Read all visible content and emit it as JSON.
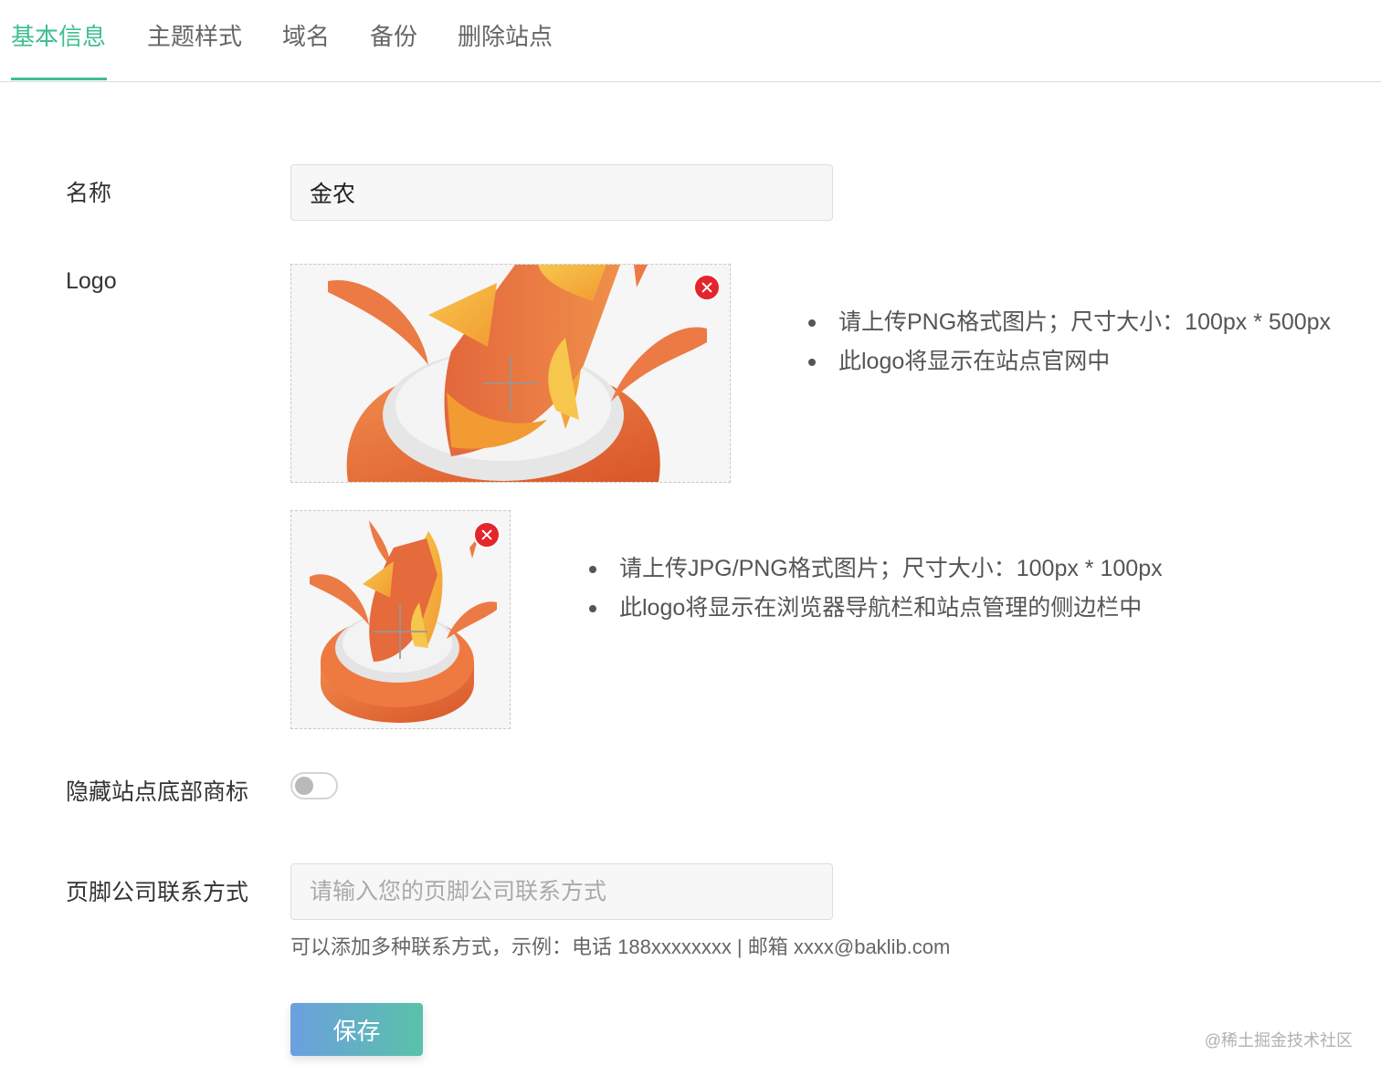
{
  "tabs": [
    {
      "label": "基本信息",
      "active": true
    },
    {
      "label": "主题样式",
      "active": false
    },
    {
      "label": "域名",
      "active": false
    },
    {
      "label": "备份",
      "active": false
    },
    {
      "label": "删除站点",
      "active": false
    }
  ],
  "form": {
    "name": {
      "label": "名称",
      "value": "金农"
    },
    "logo": {
      "label": "Logo",
      "large_hints": [
        "请上传PNG格式图片；尺寸大小：100px * 500px",
        "此logo将显示在站点官网中"
      ],
      "small_hints": [
        "请上传JPG/PNG格式图片；尺寸大小：100px * 100px",
        "此logo将显示在浏览器导航栏和站点管理的侧边栏中"
      ]
    },
    "hide_footer_brand": {
      "label": "隐藏站点底部商标",
      "enabled": false
    },
    "footer_contact": {
      "label": "页脚公司联系方式",
      "placeholder": "请输入您的页脚公司联系方式",
      "value": "",
      "help": "可以添加多种联系方式，示例：电话 188xxxxxxxx | 邮箱 xxxx@baklib.com"
    },
    "save_label": "保存"
  },
  "watermark": "@稀土掘金技术社区",
  "colors": {
    "accent": "#3fbf8f",
    "remove": "#e3262c",
    "save_gradient_start": "#6c9fe0",
    "save_gradient_end": "#59c2a8"
  },
  "icons": {
    "upload": "plus-icon",
    "remove": "close-circle-icon"
  }
}
